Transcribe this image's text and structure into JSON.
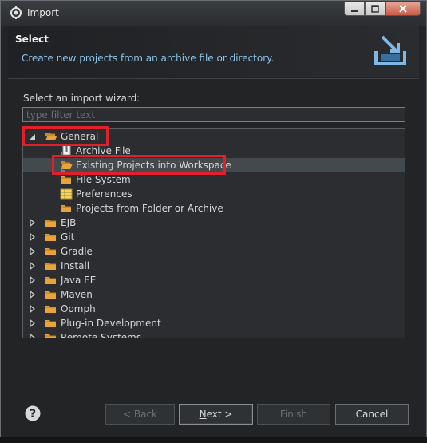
{
  "window": {
    "title": "Import"
  },
  "banner": {
    "title": "Select",
    "description": "Create new projects from an archive file or directory."
  },
  "wizard": {
    "label": "Select an import wizard:",
    "filter_placeholder": "type filter text",
    "tree": [
      {
        "label": "General",
        "expanded": true,
        "icon": "folder-open-icon",
        "level": 0
      },
      {
        "label": "Archive File",
        "icon": "archive-file-icon",
        "level": 1
      },
      {
        "label": "Existing Projects into Workspace",
        "icon": "existing-projects-icon",
        "level": 1,
        "selected": true
      },
      {
        "label": "File System",
        "icon": "folder-icon",
        "level": 1
      },
      {
        "label": "Preferences",
        "icon": "preferences-icon",
        "level": 1
      },
      {
        "label": "Projects from Folder or Archive",
        "icon": "folder-icon",
        "level": 1
      },
      {
        "label": "EJB",
        "icon": "folder-icon",
        "level": 0
      },
      {
        "label": "Git",
        "icon": "folder-icon",
        "level": 0
      },
      {
        "label": "Gradle",
        "icon": "folder-icon",
        "level": 0
      },
      {
        "label": "Install",
        "icon": "folder-icon",
        "level": 0
      },
      {
        "label": "Java EE",
        "icon": "folder-icon",
        "level": 0
      },
      {
        "label": "Maven",
        "icon": "folder-icon",
        "level": 0
      },
      {
        "label": "Oomph",
        "icon": "folder-icon",
        "level": 0
      },
      {
        "label": "Plug-in Development",
        "icon": "folder-icon",
        "level": 0
      },
      {
        "label": "Remote Systems",
        "icon": "folder-icon",
        "level": 0
      }
    ]
  },
  "buttons": {
    "back": "< Back",
    "next_mnemonic": "N",
    "next_rest": "ext >",
    "finish": "Finish",
    "cancel": "Cancel"
  },
  "colors": {
    "highlight_box": "#e0202a",
    "folder": "#e8a43a",
    "description_text": "#8cc3e8"
  }
}
